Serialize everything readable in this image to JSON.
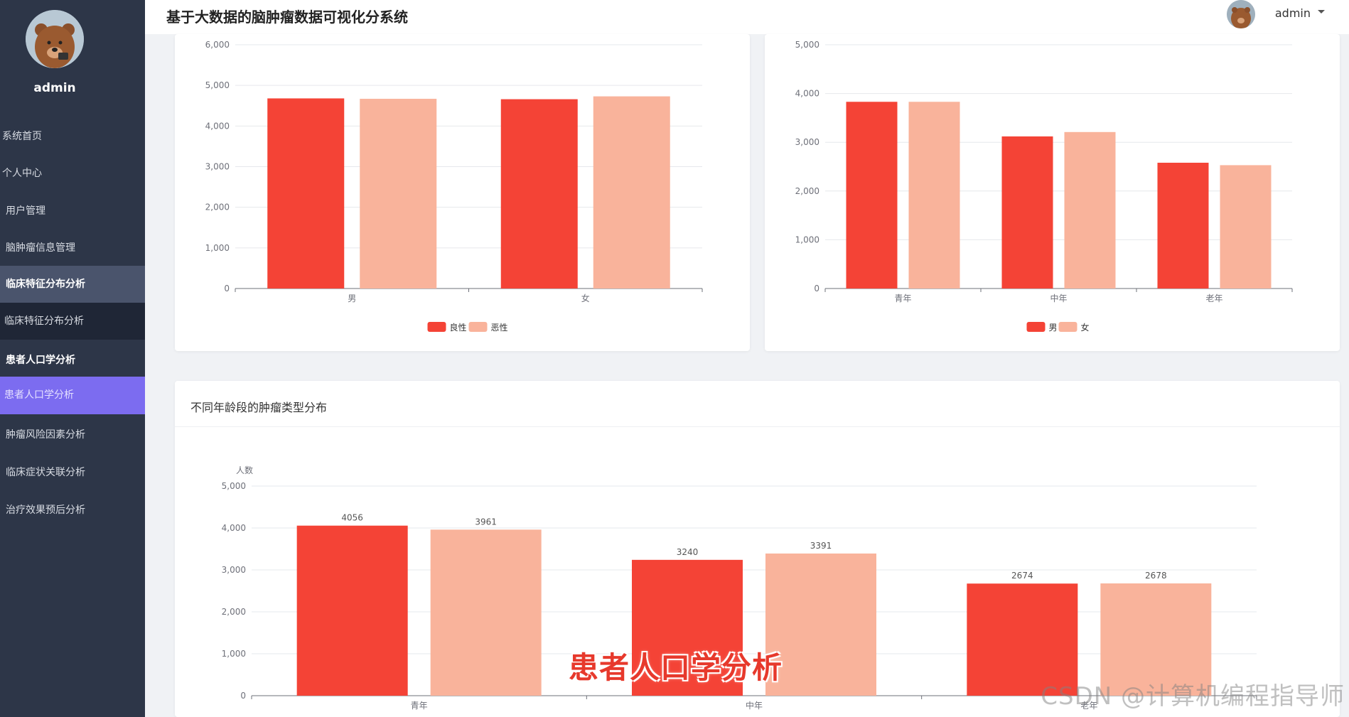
{
  "header": {
    "title": "基于大数据的脑肿瘤数据可视化分系统",
    "user": "admin"
  },
  "sidebar": {
    "user_name": "admin",
    "items": [
      {
        "label": "系统首页"
      },
      {
        "label": "个人中心"
      },
      {
        "label": "用户管理"
      },
      {
        "label": "脑肿瘤信息管理"
      },
      {
        "label": "临床特征分布分析"
      },
      {
        "label": "临床特征分布分析"
      },
      {
        "label": "患者人口学分析"
      },
      {
        "label": "患者人口学分析"
      },
      {
        "label": "肿瘤风险因素分析"
      },
      {
        "label": "临床症状关联分析"
      },
      {
        "label": "治疗效果预后分析"
      }
    ]
  },
  "colors": {
    "primary_bar": "#f44336",
    "secondary_bar": "#f9b39b",
    "active_menu": "#7c6cf0",
    "sidebar_bg": "#2d3648"
  },
  "chart_data": [
    {
      "type": "bar",
      "categories": [
        "男",
        "女"
      ],
      "series": [
        {
          "name": "良性",
          "values": [
            4680,
            4660
          ]
        },
        {
          "name": "恶性",
          "values": [
            4670,
            4730
          ]
        }
      ],
      "ylim": [
        0,
        6000
      ],
      "yticks": [
        "0",
        "1,000",
        "2,000",
        "3,000",
        "4,000",
        "5,000",
        "6,000"
      ],
      "legend": "bottom-center"
    },
    {
      "type": "bar",
      "categories": [
        "青年",
        "中年",
        "老年"
      ],
      "series": [
        {
          "name": "男",
          "values": [
            3830,
            3120,
            2580
          ]
        },
        {
          "name": "女",
          "values": [
            3830,
            3210,
            2530
          ]
        }
      ],
      "ylim": [
        0,
        5000
      ],
      "yticks": [
        "0",
        "1,000",
        "2,000",
        "3,000",
        "4,000",
        "5,000"
      ],
      "legend": "bottom-center"
    },
    {
      "type": "bar",
      "title": "不同年龄段的肿瘤类型分布",
      "ylabel": "人数",
      "categories": [
        "青年",
        "中年",
        "老年"
      ],
      "series": [
        {
          "values": [
            4056,
            3240,
            2674
          ],
          "labels": [
            "4056",
            "3240",
            "2674"
          ]
        },
        {
          "values": [
            3961,
            3391,
            2678
          ],
          "labels": [
            "3961",
            "3391",
            "2678"
          ]
        }
      ],
      "ylim": [
        0,
        5000
      ],
      "yticks": [
        "0",
        "1,000",
        "2,000",
        "3,000",
        "4,000",
        "5,000"
      ]
    }
  ],
  "overlay": {
    "caption": "患者人口学分析",
    "watermark": "CSDN @计算机编程指导师"
  }
}
